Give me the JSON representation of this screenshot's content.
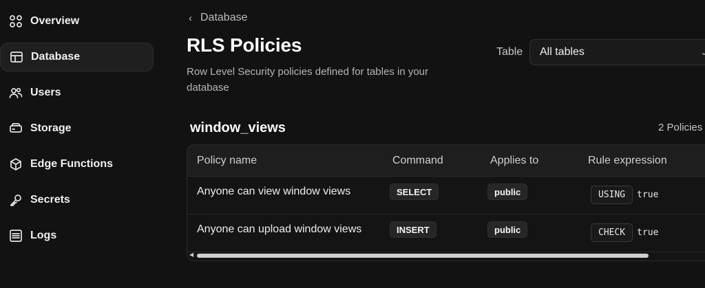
{
  "sidebar": {
    "items": [
      {
        "label": "Overview",
        "icon": "grid-icon",
        "active": false
      },
      {
        "label": "Database",
        "icon": "table-icon",
        "active": true
      },
      {
        "label": "Users",
        "icon": "users-icon",
        "active": false
      },
      {
        "label": "Storage",
        "icon": "drive-icon",
        "active": false
      },
      {
        "label": "Edge Functions",
        "icon": "cube-icon",
        "active": false
      },
      {
        "label": "Secrets",
        "icon": "key-icon",
        "active": false
      },
      {
        "label": "Logs",
        "icon": "list-icon",
        "active": false
      }
    ]
  },
  "breadcrumb": {
    "label": "Database"
  },
  "page": {
    "title": "RLS Policies",
    "subtitle": "Row Level Security policies defined for tables in your database"
  },
  "filter": {
    "label": "Table",
    "selected": "All tables"
  },
  "section": {
    "title": "window_views",
    "count": "2 Policies"
  },
  "table": {
    "columns": [
      "Policy name",
      "Command",
      "Applies to",
      "Rule expression"
    ],
    "rows": [
      {
        "name": "Anyone can view window views",
        "command": "SELECT",
        "applies_to": "public",
        "rule_keyword": "USING",
        "rule_value": "true"
      },
      {
        "name": "Anyone can upload window views",
        "command": "INSERT",
        "applies_to": "public",
        "rule_keyword": "CHECK",
        "rule_value": "true"
      }
    ]
  },
  "colors": {
    "background": "#121212",
    "active_item": "#1f1f1f",
    "table_header": "#1e1e1e"
  }
}
